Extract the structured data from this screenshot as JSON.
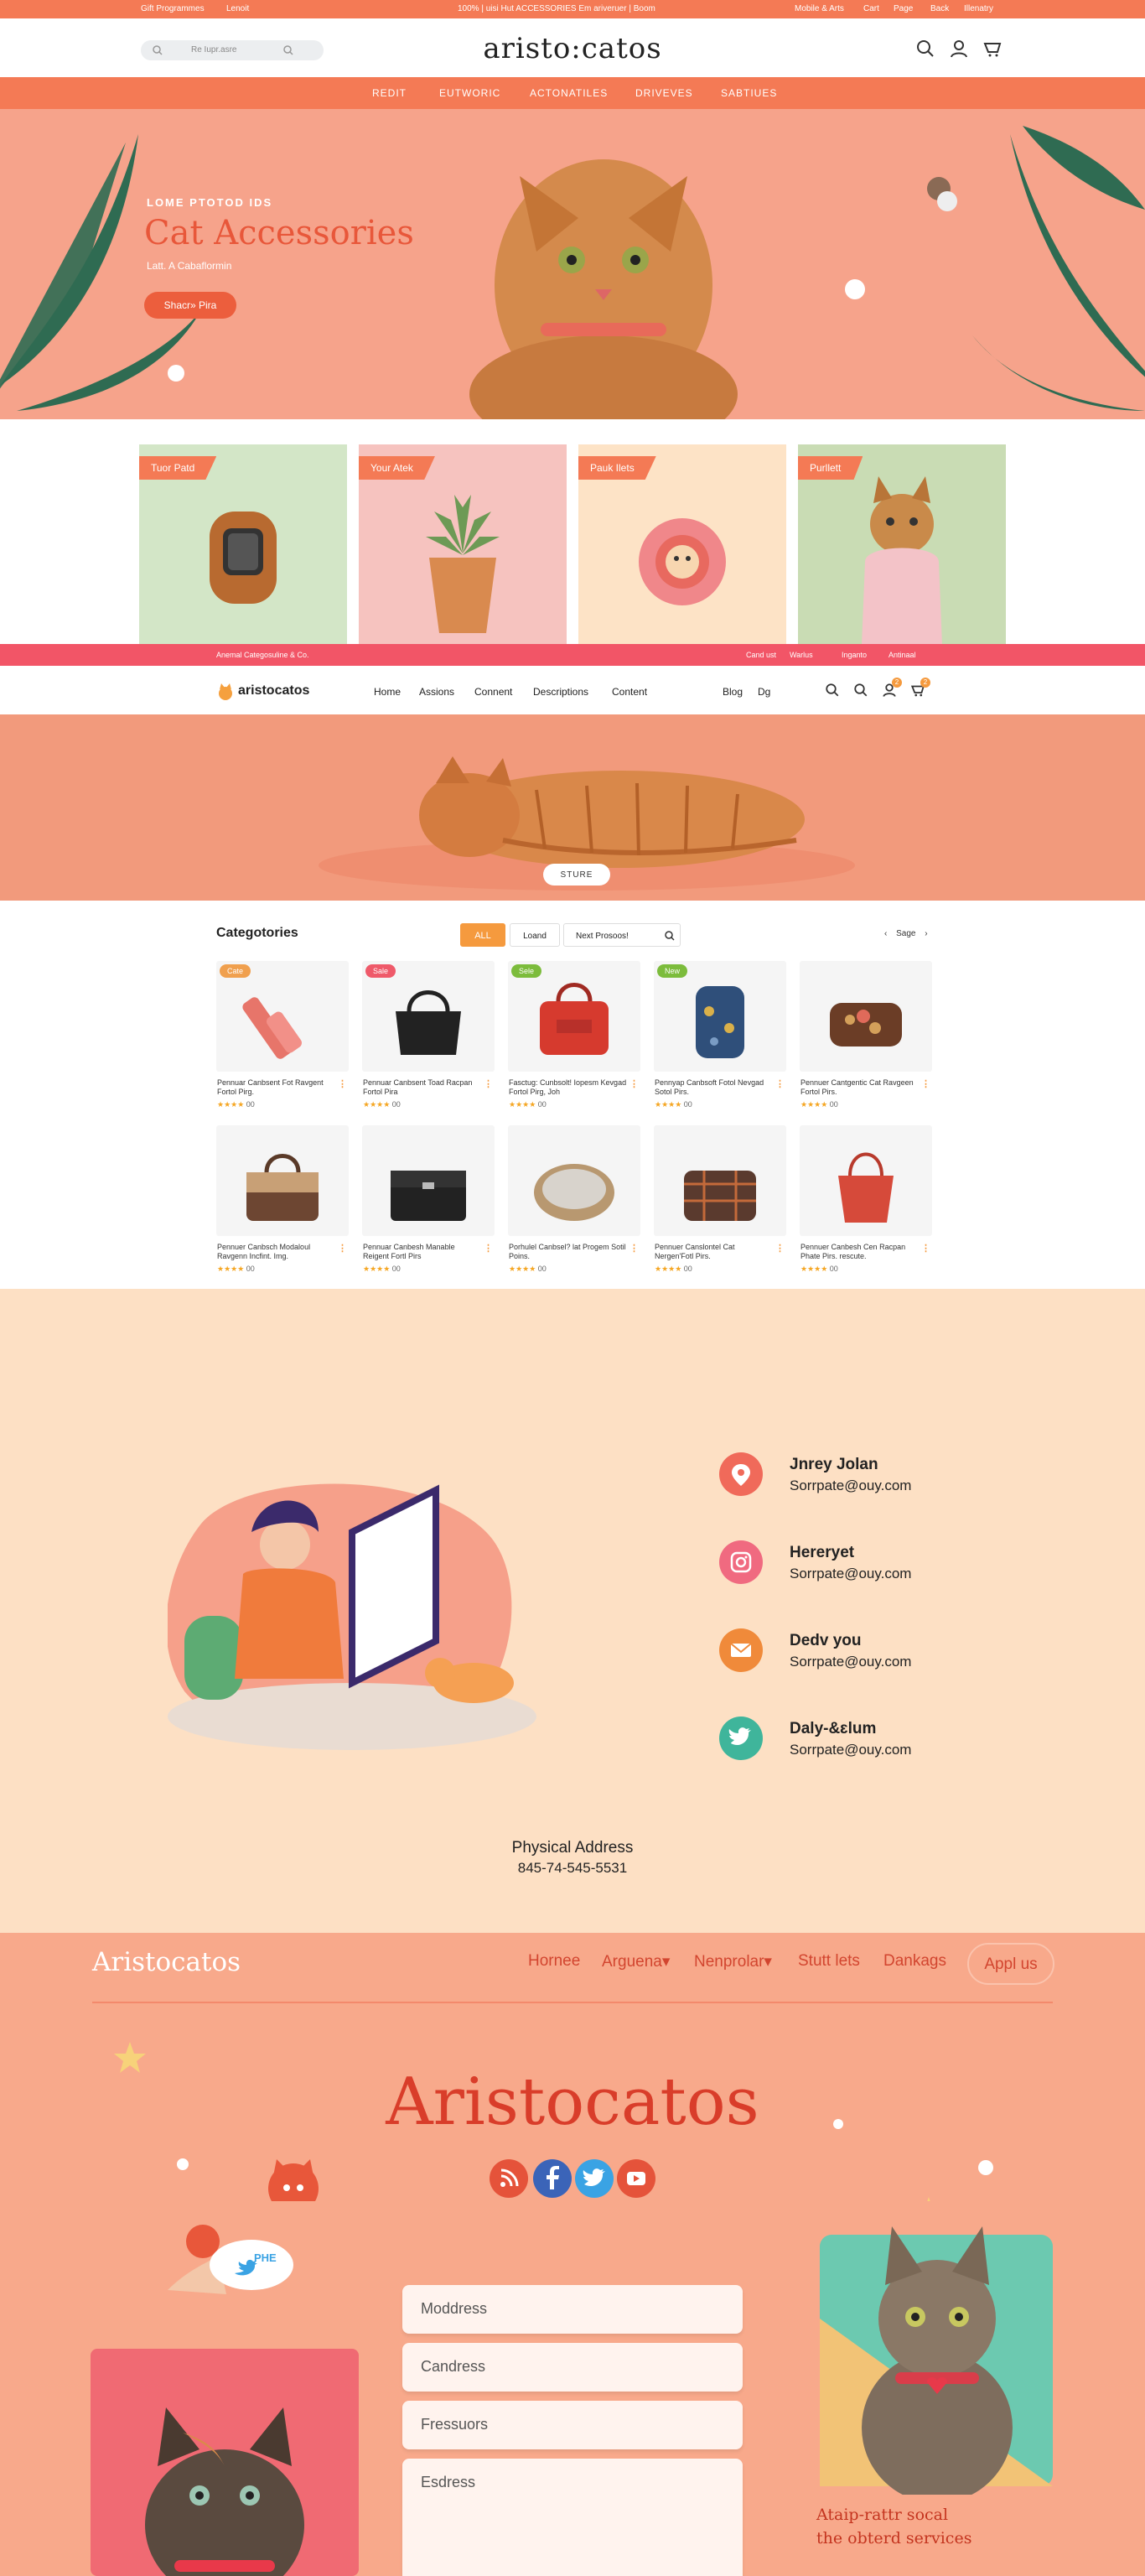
{
  "topbar": {
    "left_a": "Gift Programmes",
    "left_b": "Lenoit",
    "center": "100% | uisi Hut ACCESSORIES Em ariveruer | Boom",
    "right": [
      "Mobile & Arts",
      "Cart",
      "Page",
      "Back",
      "Illenatry"
    ]
  },
  "header": {
    "logo": "aristo:catos",
    "search_placeholder": "Re Iupr.asre"
  },
  "main_nav": [
    "REDIT",
    "EUTWORIC",
    "ACTONATILES",
    "DRIVEVES",
    "SABTIUES"
  ],
  "hero": {
    "eyebrow": "LOME PTOTOD IDS",
    "title": "Cat Accessories",
    "line": "Latt. A Cabaflormin",
    "button": "Shacr» Pira"
  },
  "promo_cards": [
    {
      "tag": "Tuor Patd"
    },
    {
      "tag": "Your Atek"
    },
    {
      "tag": "Pauk Ilets"
    },
    {
      "tag": "Purllett"
    }
  ],
  "secondary_strip": {
    "left": "Anemal Categosuline & Co.",
    "right": [
      "Cand ust",
      "Warlus",
      "Inganto",
      "Antinaal"
    ]
  },
  "header2": {
    "logo": "aristocatos",
    "nav": [
      "Home",
      "Assions",
      "Connent",
      "Descriptions",
      "Content"
    ],
    "nav_right": [
      "Blog",
      "Dg"
    ],
    "badges": [
      "2",
      "2"
    ]
  },
  "hero2": {
    "button": "STURE"
  },
  "catalog": {
    "title": "Categotories",
    "filter_all": "ALL",
    "filter_load": "Loand",
    "search_placeholder": "Next Prosoos!",
    "pager": "Sage",
    "products": [
      {
        "badge": "Cate",
        "badge_color": "#f0a04e",
        "name": "Pennuar Canbsent Fot Ravgent Fortol Pirg.",
        "rating": "★★★★",
        "reviews": "00"
      },
      {
        "badge": "Sale",
        "badge_color": "#ef5a6a",
        "name": "Pennuar Canbsent Toad Racpan Fortol Pira",
        "rating": "★★★★",
        "reviews": "00"
      },
      {
        "badge": "Sele",
        "badge_color": "#7cbc3c",
        "name": "Fasctug: Cunbsolt! Iopesm Kevgad Fortol Pirg, Joh",
        "rating": "★★★★",
        "reviews": "00"
      },
      {
        "badge": "New",
        "badge_color": "#7cbc3c",
        "name": "Pennyap Canbsoft Fotol Nevgad Sotol Pirs.",
        "rating": "★★★★",
        "reviews": "00"
      },
      {
        "badge": "",
        "badge_color": "",
        "name": "Pennuer Cantgentic Cat Ravgeen Fortol Pirs.",
        "rating": "★★★★",
        "reviews": "00"
      },
      {
        "badge": "",
        "badge_color": "",
        "name": "Pennuer Canbsch Modaloul Ravgenn Incfint. Img.",
        "rating": "★★★★",
        "reviews": "00"
      },
      {
        "badge": "",
        "badge_color": "",
        "name": "Pennuar Canbesh Manable Reigent Fortl Pirs",
        "rating": "★★★★",
        "reviews": "00"
      },
      {
        "badge": "",
        "badge_color": "",
        "name": "Porhulel Canbsel? lat Progem Sotil Poins.",
        "rating": "★★★★",
        "reviews": "00"
      },
      {
        "badge": "",
        "badge_color": "",
        "name": "Pennuer Canslontel Cat Nergen'Fotl Pirs.",
        "rating": "★★★★",
        "reviews": "00"
      },
      {
        "badge": "",
        "badge_color": "",
        "name": "Pennuer Canbesh Cen Racpan Phate Pirs. rescute.",
        "rating": "★★★★",
        "reviews": "00"
      }
    ]
  },
  "contact": {
    "items": [
      {
        "icon": "location-icon",
        "color": "#f06a5a",
        "name": "Jnrey Jolan",
        "value": "Sorrpate@ouy.com"
      },
      {
        "icon": "instagram-icon",
        "color": "#f06a80",
        "name": "Hereryet",
        "value": "Sorrpate@ouy.com"
      },
      {
        "icon": "mail-icon",
        "color": "#f08a3a",
        "name": "Dedv you",
        "value": "Sorrpate@ouy.com"
      },
      {
        "icon": "twitter-icon",
        "color": "#3fb59b",
        "name": "Daly-&ɛlum",
        "value": "Sorrpate@ouy.com"
      }
    ],
    "address_label": "Physical Address",
    "address_value": "845-74-545-5531"
  },
  "footer": {
    "logo": "Aristocatos",
    "nav": [
      "Hornee",
      "Arguena▾",
      "Nenprolar▾",
      "Stutt lets",
      "Dankags"
    ],
    "cta": "Appl us",
    "brand": "Aristocatos",
    "sticker": "PHE",
    "social": [
      {
        "icon": "rss-icon",
        "color": "#e5533a"
      },
      {
        "icon": "facebook-icon",
        "color": "#3b64b8"
      },
      {
        "icon": "twitter-icon",
        "color": "#3aa3e4"
      },
      {
        "icon": "youtube-icon",
        "color": "#e5533a"
      }
    ],
    "form": {
      "field1": "Moddress",
      "field2": "Candress",
      "field3": "Fressuors",
      "message": "Esdress"
    },
    "caption_line1": "Ataip-rattr socal",
    "caption_line2": "the obterd services"
  }
}
